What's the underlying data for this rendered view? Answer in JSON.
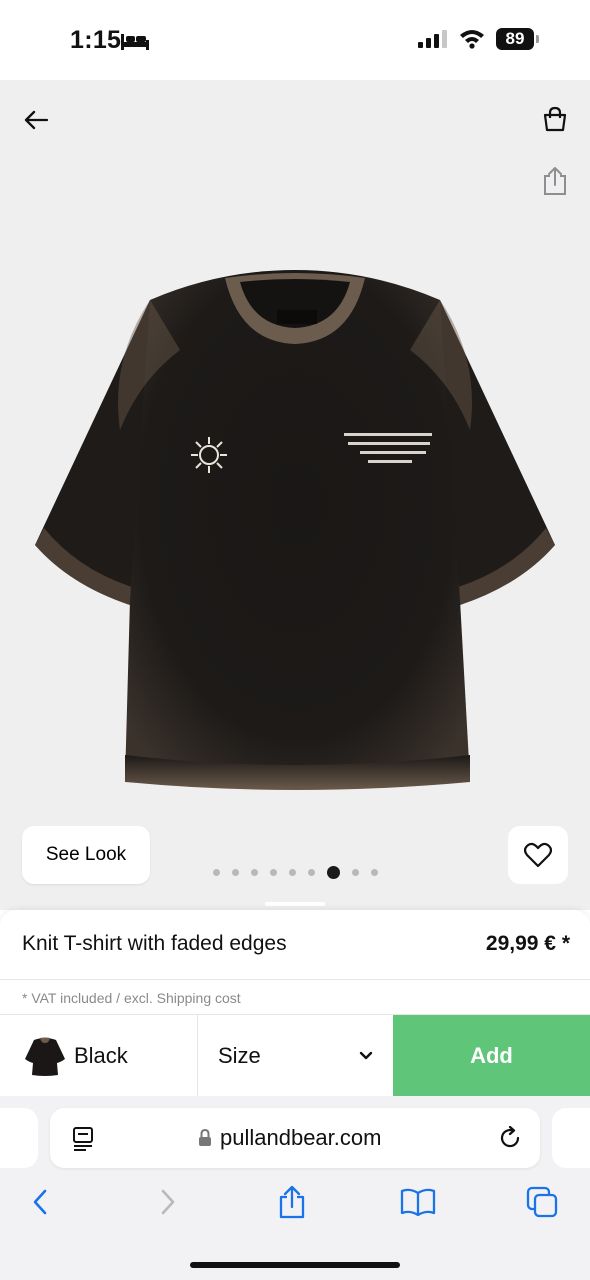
{
  "status_bar": {
    "time": "1:15",
    "battery": "89"
  },
  "gallery": {
    "see_look_label": "See Look",
    "image_count": 9,
    "active_image_index": 6
  },
  "product": {
    "name": "Knit T-shirt with faded edges",
    "price": "29,99 € *",
    "vat_note": "* VAT included / excl. Shipping cost",
    "color_label": "Black",
    "size_label": "Size",
    "add_label": "Add"
  },
  "browser": {
    "url": "pullandbear.com"
  },
  "colors": {
    "add_button": "#5fc679",
    "gallery_bg": "#efeff0",
    "toolbar_blue": "#1a73e8"
  },
  "icons": {
    "back": "arrow-left-icon",
    "bag": "shopping-bag-icon",
    "share": "share-icon",
    "heart": "heart-icon",
    "chevron": "chevron-down-icon",
    "reader": "reader-mode-icon",
    "lock": "lock-icon",
    "reload": "reload-icon",
    "nav_back": "chevron-left-icon",
    "nav_forward": "chevron-right-icon",
    "bookmarks": "book-icon",
    "tabs": "tabs-icon"
  }
}
